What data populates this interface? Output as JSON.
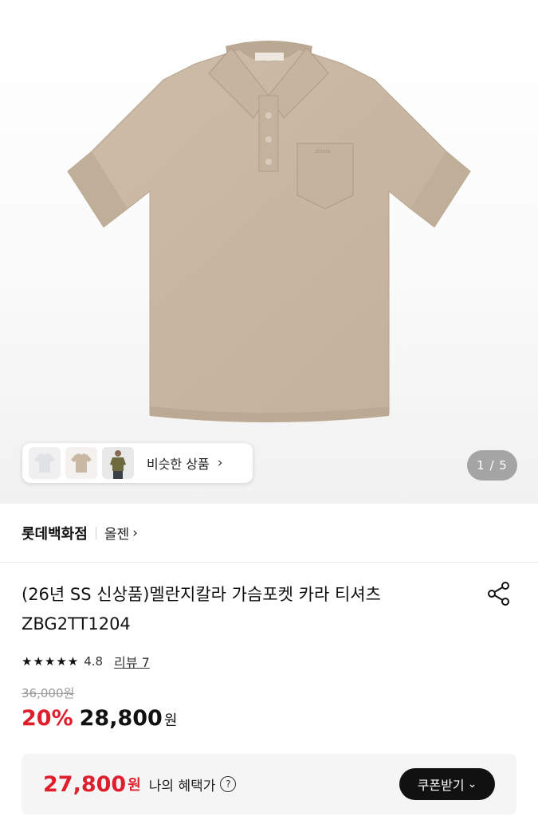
{
  "gallery": {
    "counter": "1 / 5",
    "similar_label": "비슷한 상품",
    "similar_chevron": "›",
    "thumbnails": [
      "white-shirt-thumbnail",
      "beige-shirt-thumbnail",
      "model-olive-shirt-thumbnail"
    ],
    "shirt_color": "#c9b8a3"
  },
  "store": {
    "name": "롯데백화점",
    "brand": "올젠",
    "brand_chevron": "›"
  },
  "product": {
    "title_line1": "(26년 SS 신상품)멜란지칼라 가슴포켓 카라 티셔츠",
    "title_line2": "ZBG2TT1204",
    "share_icon": "share-icon",
    "stars": "★★★★★",
    "rating": "4.8",
    "review_link": "리뷰 7",
    "original_price": "36,000원",
    "discount": "20%",
    "sale_price": "28,800",
    "sale_unit": "원"
  },
  "benefit": {
    "price": "27,800",
    "unit": "원",
    "label": "나의 혜택가",
    "help": "?",
    "coupon_button": "쿠폰받기",
    "coupon_chevron": "⌄"
  },
  "colors": {
    "accent_red": "#e01f2d",
    "button_black": "#111111"
  }
}
